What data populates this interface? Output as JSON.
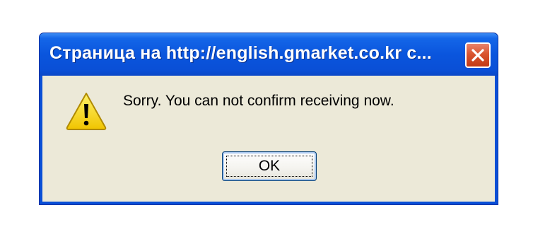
{
  "window": {
    "title": "Страница на http://english.gmarket.co.kr c...",
    "close_icon": "close-icon",
    "colors": {
      "titlebar": "#0a55dd",
      "client_background": "#ece9d8",
      "close_button": "#d9542f"
    }
  },
  "body": {
    "icon": "warning-icon",
    "message": "Sorry. You can not confirm receiving now."
  },
  "buttons": {
    "ok_label": "OK"
  }
}
